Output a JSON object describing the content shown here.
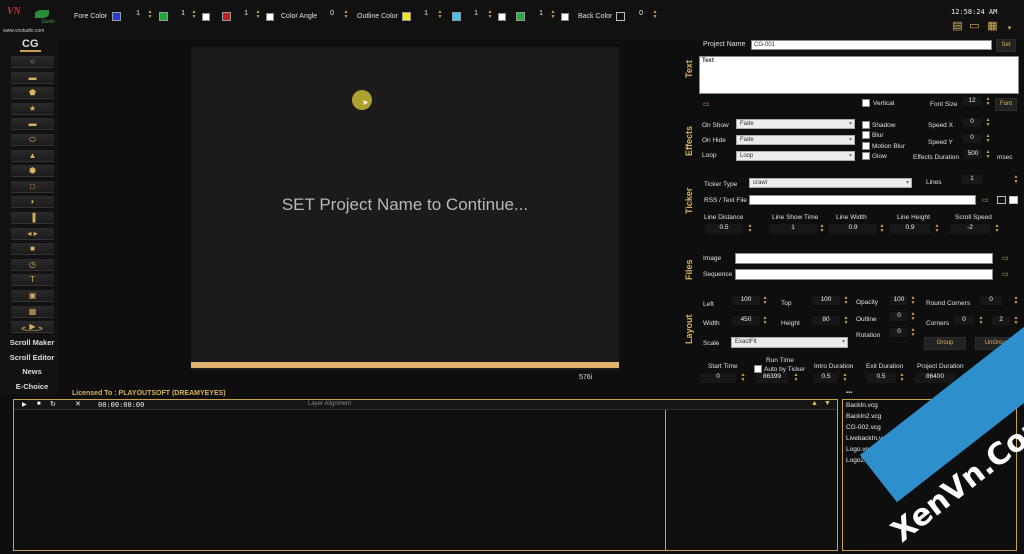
{
  "logo": {
    "brand": "VN",
    "studio": "Studio",
    "site": "www.vnstudio.com",
    "cg_label": "CG"
  },
  "topbar": {
    "fore_color_label": "Fore Color",
    "fore_values": [
      "1",
      "1",
      "1"
    ],
    "color_angle_label": "Color Angle",
    "color_angle_value": "0",
    "outline_color_label": "Outline Color",
    "outline_values": [
      "1",
      "1",
      "1"
    ],
    "back_color_label": "Back Color",
    "back_value": "0",
    "clock": "12:58:24 AM",
    "colors": {
      "blue": "#1f3fd8",
      "green": "#1fa83a",
      "red": "#c02020",
      "white": "#ffffff",
      "yellow": "#f3e61b",
      "cyan": "#3cc8e8",
      "green2": "#22b03c",
      "black": "#111111"
    }
  },
  "left_toolbar": {
    "icons": [
      "circle-tool",
      "rect-tool",
      "pentagon-tool",
      "star-tool",
      "rounded-rect-tool",
      "ellipse-tool",
      "triangle-tool",
      "hexagon-tool",
      "square-tool",
      "shield-tool",
      "banner-tool",
      "arrows-tool",
      "rounded-square-tool",
      "clock-tool",
      "text-tool",
      "image-tool",
      "film-tool",
      "video-tool"
    ],
    "glyphs": [
      "○",
      "▬",
      "⬟",
      "★",
      "▬",
      "⬭",
      "▲",
      "⬢",
      "□",
      "◗",
      "▐",
      "◂ ▸",
      "■",
      "◷",
      "T",
      "▣",
      "▦",
      "▶"
    ],
    "range_label": "<......>",
    "buttons": [
      "Scroll Maker",
      "Scroll Editor",
      "News",
      "E-Choice"
    ]
  },
  "canvas": {
    "message": "SET Project Name to Continue...",
    "frame_label": "576i"
  },
  "right": {
    "project_name_label": "Project Name",
    "project_name_value": "CG-001",
    "set_button": "Set",
    "text_section": "Text",
    "text_value": "Text",
    "vertical_label": "Vertical",
    "font_size_label": "Font Size",
    "font_size_value": "12",
    "font_button": "Font",
    "effects_section": "Effects",
    "on_show_label": "On Show",
    "on_show_value": "Fade",
    "on_hide_label": "On Hide",
    "on_hide_value": "Fade",
    "loop_label": "Loop",
    "loop_value": "Loop",
    "shadow_label": "Shadow",
    "blur_label": "Blur",
    "motion_blur_label": "Motion Blur",
    "glow_label": "Glow",
    "speed_x_label": "Speed X",
    "speed_x_value": "0",
    "speed_y_label": "Speed Y",
    "speed_y_value": "0",
    "effects_duration_label": "Effects Duration",
    "effects_duration_value": "500",
    "msec_label": "msec",
    "ticker_section": "Ticker",
    "ticker_type_label": "Ticker Type",
    "ticker_type_value": "crawl",
    "lines_label": "Lines",
    "lines_value": "1",
    "rss_label": "RSS / Text File",
    "line_distance_label": "Line Distance",
    "line_distance_value": "0.5",
    "line_show_time_label": "Line Show Time",
    "line_show_time_value": "1",
    "line_width_label": "Line Width",
    "line_width_value": "0.9",
    "line_height_label": "Line Height",
    "line_height_value": "0.9",
    "scroll_speed_label": "Scroll Speed",
    "scroll_speed_value": "-2",
    "files_section": "Files",
    "image_label": "Image",
    "sequence_label": "Sequence",
    "layout_section": "Layout",
    "left_label": "Left",
    "left_value": "100",
    "top_label": "Top",
    "top_value": "100",
    "opacity_label": "Opacity",
    "opacity_value": "100",
    "round_corners_label": "Round Corners",
    "round_corners_value": "0",
    "width_label": "Width",
    "width_value": "450",
    "height_label": "Height",
    "height_value": "80",
    "outline_label": "Outline",
    "outline_value": "0",
    "corners_label": "Corners",
    "corners_value1": "0",
    "corners_value2": "2",
    "rotation_label": "Rotation",
    "rotation_value": "0",
    "scale_label": "Scale",
    "scale_value": "ExactFit",
    "group_button": "Group",
    "ungroup_button": "UnGroup",
    "start_time_label": "Start Time",
    "start_time_value": "0",
    "run_time_label": "Run Time",
    "auto_by_ticker_label": "Auto by Ticker",
    "run_time_value": "86399",
    "intro_duration_label": "Intro Duration",
    "intro_duration_value": "0.5",
    "exit_duration_label": "Exit Duration",
    "exit_duration_value": "0.5",
    "project_duration_label": "Project Duration",
    "project_duration_value": "86400",
    "update_button": "Update"
  },
  "bottom": {
    "licensed": "Licensed To : PLAYOUTSOFT (DREAMYEYES)",
    "timecode": "00:00:00:00",
    "layer_alignment": "Layer Alignment",
    "files": [
      "BackIn.vcg",
      "BackIn2.vcg",
      "CG-002.vcg",
      "LivebackIn.vcg",
      "Logo.vcg",
      "Logo2.vcg"
    ]
  },
  "watermark": "XenVn.Com"
}
